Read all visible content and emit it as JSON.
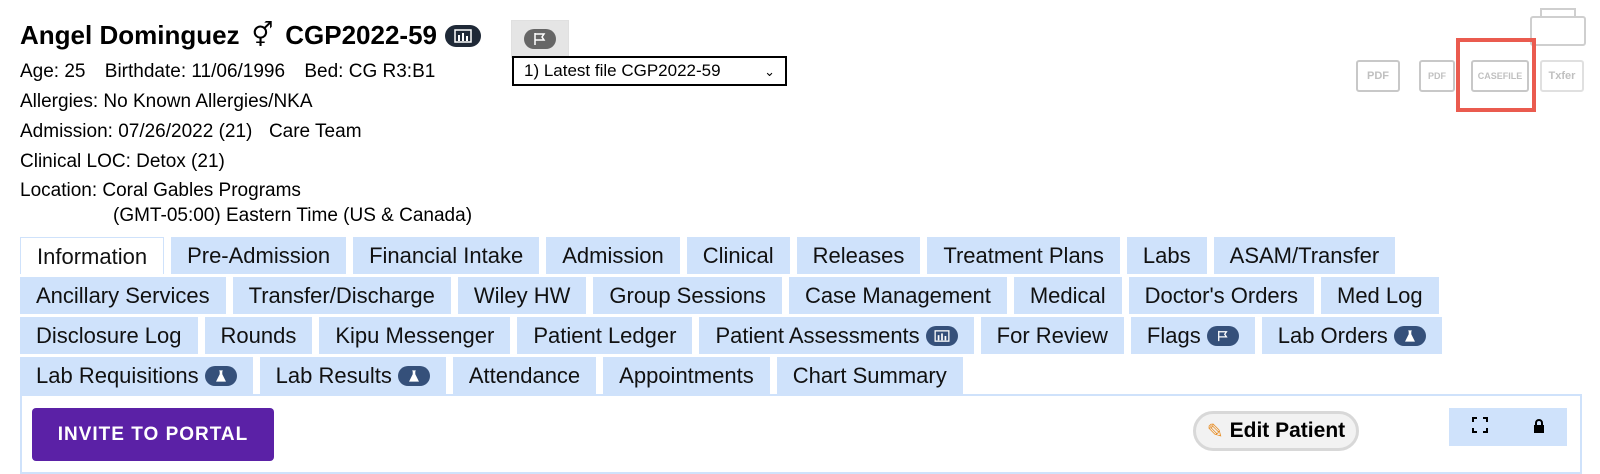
{
  "patient": {
    "name": "Angel Dominguez",
    "gender_icon": "⚥",
    "id": "CGP2022-59"
  },
  "details": {
    "age": "Age: 25",
    "birthdate": "Birthdate: 11/06/1996",
    "bed": "Bed: CG R3:B1",
    "allergies": "Allergies: No Known Allergies/NKA",
    "admission": "Admission: 07/26/2022 (21)",
    "care_team": "Care Team",
    "clinical_loc": "Clinical LOC: Detox (21)",
    "location": "Location: Coral Gables Programs",
    "timezone": "(GMT-05:00) Eastern Time (US & Canada)"
  },
  "file_select": {
    "value": "1) Latest file CGP2022-59"
  },
  "doc_icons": {
    "pdf1": "PDF",
    "pdf2": "PDF",
    "casefile": "CASEFILE",
    "txfer": "Txfer"
  },
  "tabs": {
    "row1": [
      "Information",
      "Pre-Admission",
      "Financial Intake",
      "Admission",
      "Clinical",
      "Releases",
      "Treatment Plans",
      "Labs",
      "ASAM/Transfer"
    ],
    "row2": [
      "Ancillary Services",
      "Transfer/Discharge",
      "Wiley HW",
      "Group Sessions",
      "Case Management",
      "Medical",
      "Doctor's Orders",
      "Med Log"
    ],
    "row3": [
      "Disclosure Log",
      "Rounds",
      "Kipu Messenger",
      "Patient Ledger",
      "Patient Assessments",
      "For Review",
      "Flags",
      "Lab Orders"
    ],
    "row4": [
      "Lab Requisitions",
      "Lab Results",
      "Attendance",
      "Appointments",
      "Chart Summary"
    ]
  },
  "buttons": {
    "invite": "INVITE TO PORTAL",
    "edit_patient": "Edit Patient"
  },
  "colors": {
    "tab_bg": "#cfe2fb",
    "invite_bg": "#5b21a6",
    "highlight": "#ea5b4f"
  }
}
